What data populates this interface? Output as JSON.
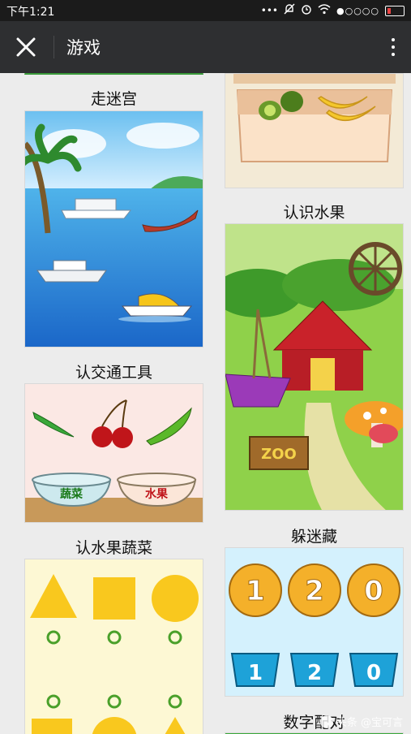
{
  "status_bar": {
    "time": "下午1:21",
    "signal_dots": "●○○○○"
  },
  "header": {
    "title": "游戏"
  },
  "games": [
    {
      "caption": "走迷宫"
    },
    {
      "caption": "认识水果"
    },
    {
      "caption": "认交通工具"
    },
    {
      "caption": "躲迷藏"
    },
    {
      "caption": "认水果蔬菜"
    },
    {
      "caption": "数字配对"
    }
  ],
  "labels": {
    "vegetable_bowl": "蔬菜",
    "fruit_bowl": "水果",
    "zoo_sign": "ZOO"
  },
  "number_cards": {
    "balls": [
      "1",
      "2",
      "0"
    ],
    "cups": [
      "1",
      "2",
      "0"
    ]
  },
  "watermark": {
    "text": "头条 @宝可言"
  },
  "colors": {
    "status_bg": "#1b1b1b",
    "topbar_bg": "#2e2f31",
    "page_bg": "#ececec"
  }
}
